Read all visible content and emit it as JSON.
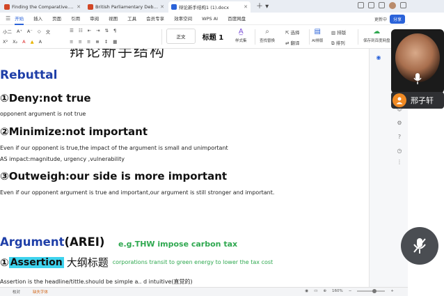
{
  "tabs": [
    {
      "icon": "ppt",
      "title": "Finding the Comparative.pptx"
    },
    {
      "icon": "ppt",
      "title": "British Parliamentary Debate Gui..."
    },
    {
      "icon": "word",
      "title": "辩论新手结构1 (1).docx",
      "active": true
    }
  ],
  "menu": {
    "items": [
      "开始",
      "插入",
      "页面",
      "引用",
      "审阅",
      "视图",
      "工具",
      "会员专享",
      "效率空间",
      "WPS AI",
      "百度网盘"
    ],
    "right": {
      "update": "更新中",
      "share": "分享"
    }
  },
  "ribbon": {
    "font_size_value": "小二",
    "style_normal": "正文",
    "style_heading": "标题 1",
    "style_set": "样式集",
    "find_replace": "查找替换",
    "select": "选择",
    "translate": "翻译",
    "ai_layout": "AI排版",
    "layout": "排版",
    "arrange": "排列",
    "save_baidu": "保存到百度网盘"
  },
  "document": {
    "title": "辩论新手结构",
    "rebuttal_heading": "Rebuttal",
    "deny_heading": "①Deny:not true",
    "deny_text": "opponent argument is not true",
    "minimize_heading": "②Minimize:not important",
    "minimize_text_1": "Even if our opponent is true,the impact of the argument is small and unimportant",
    "minimize_text_2": "AS impact:magnitude, urgency ,vulnerability",
    "outweigh_heading": "③Outweigh:our side is more important",
    "outweigh_text": "Even if our opponent argument is true and important,our argument is still stronger and important.",
    "argument_heading_blue": "Argument",
    "argument_heading_black": "(AREI)",
    "example": "e.g.THW impose carbon tax",
    "assertion_circle": "①",
    "assertion_word": "Assertion",
    "assertion_cn": "大纲标题",
    "assertion_example": "corporations transit to green energy to lower the tax cost",
    "assertion_desc": "Assertion is the headline/tittle.should be simple a.. d intuitive(直觉的)"
  },
  "participant": {
    "name": "邢子轩"
  },
  "status": {
    "page": "校对",
    "missing_font": "缺失字体",
    "zoom": "160%"
  },
  "colors": {
    "accent": "#2b63d9",
    "heading_blue": "#1f3fa8",
    "example_green": "#2ea84f",
    "highlight": "#3ed3ee",
    "avatar_orange": "#f08a24"
  }
}
